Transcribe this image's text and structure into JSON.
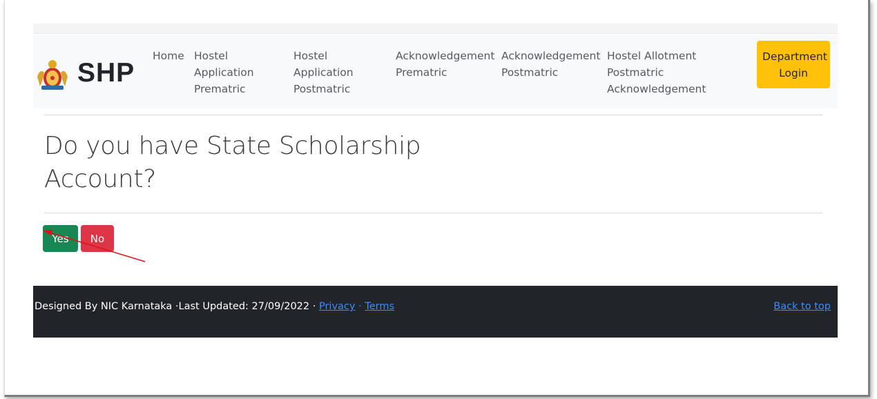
{
  "brand": {
    "name": "SHP",
    "logo_icon": "karnataka-emblem-icon"
  },
  "nav": {
    "items": [
      {
        "label": "Home"
      },
      {
        "label": "Hostel Application Prematric"
      },
      {
        "label": "Hostel Application Postmatric"
      },
      {
        "label": "Acknowledgement Prematric"
      },
      {
        "label": "Acknowledgement Postmatric"
      },
      {
        "label": "Hostel Allotment Postmatric Acknowledgement"
      }
    ],
    "department_login": "Department Login"
  },
  "main": {
    "question": "Do you have State Scholarship Account?",
    "yes_label": "Yes",
    "no_label": "No"
  },
  "footer": {
    "credit": "Designed By NIC Karnataka ·Last Updated: 27/09/2022 · ",
    "privacy": "Privacy",
    "separator": " · ",
    "terms": "Terms",
    "back_to_top": "Back to top"
  },
  "colors": {
    "navbar_bg": "#f8f9fa",
    "department_button": "#ffc107",
    "yes_button": "#198754",
    "no_button": "#dc3545",
    "footer_bg": "#212529",
    "link": "#3d8bfd",
    "annotation_arrow": "#e0101a"
  }
}
